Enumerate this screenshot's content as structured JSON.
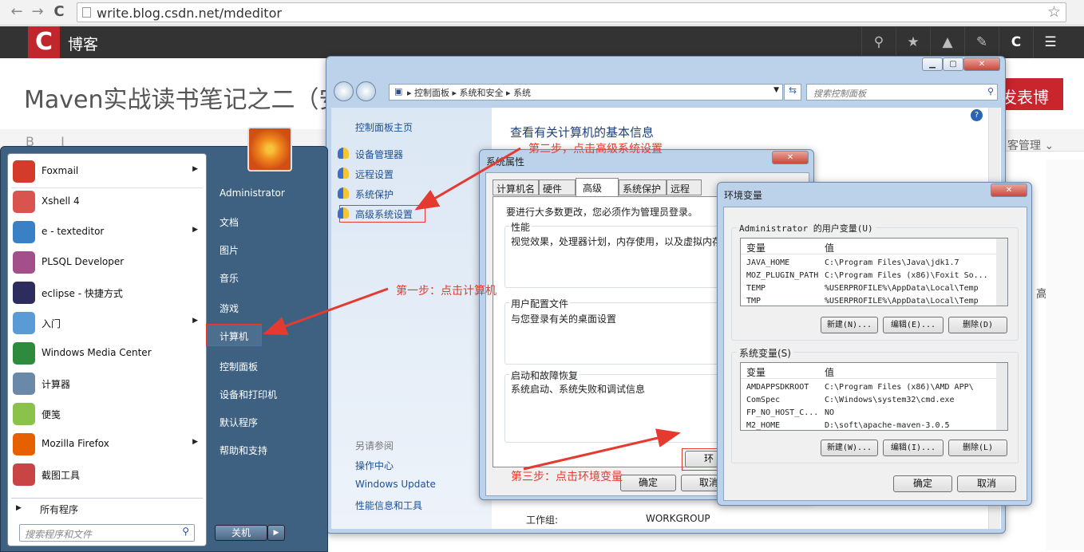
{
  "browser": {
    "url": "write.blog.csdn.net/mdeditor",
    "back": "←",
    "forward": "→",
    "reload": "C",
    "star": "☆"
  },
  "csdn": {
    "logo": "C",
    "blog": "博客"
  },
  "editor": {
    "title": "Maven实战读书笔记之二（安",
    "publish": "发表博客",
    "toolbar": "B I",
    "manage": "客管理",
    "fragment": "高"
  },
  "control_panel": {
    "breadcrumb": [
      "控制面板",
      "系统和安全",
      "系统"
    ],
    "search_placeholder": "搜索控制面板",
    "home": "控制面板主页",
    "links": [
      "设备管理器",
      "远程设置",
      "系统保护",
      "高级系统设置"
    ],
    "heading": "查看有关计算机的基本信息",
    "see_also": "另请参阅",
    "see_also_links": [
      "操作中心",
      "Windows Update",
      "性能信息和工具"
    ],
    "workgroup_label": "工作组:",
    "workgroup_value": "WORKGROUP"
  },
  "sys_props": {
    "title": "系统属性",
    "tabs": [
      "计算机名",
      "硬件",
      "高级",
      "系统保护",
      "远程"
    ],
    "admin_note": "要进行大多数更改，您必须作为管理员登录。",
    "perf_title": "性能",
    "perf_desc": "视觉效果，处理器计划，内存使用，以及虚拟内存",
    "profile_title": "用户配置文件",
    "profile_desc": "与您登录有关的桌面设置",
    "startup_title": "启动和故障恢复",
    "startup_desc": "系统启动、系统失败和调试信息",
    "env_btn": "环",
    "ok": "确定",
    "cancel": "取消"
  },
  "env_vars": {
    "title": "环境变量",
    "user_group": "Administrator 的用户变量(U)",
    "col_var": "变量",
    "col_val": "值",
    "user_rows": [
      [
        "JAVA_HOME",
        "C:\\Program Files\\Java\\jdk1.7"
      ],
      [
        "MOZ_PLUGIN_PATH",
        "C:\\Program Files (x86)\\Foxit So..."
      ],
      [
        "TEMP",
        "%USERPROFILE%\\AppData\\Local\\Temp"
      ],
      [
        "TMP",
        "%USERPROFILE%\\AppData\\Local\\Temp"
      ]
    ],
    "user_buttons": [
      "新建(N)...",
      "编辑(E)...",
      "删除(D)"
    ],
    "sys_group": "系统变量(S)",
    "sys_rows": [
      [
        "AMDAPPSDKROOT",
        "C:\\Program Files (x86)\\AMD APP\\"
      ],
      [
        "ComSpec",
        "C:\\Windows\\system32\\cmd.exe"
      ],
      [
        "FP_NO_HOST_C...",
        "NO"
      ],
      [
        "M2_HOME",
        "D:\\soft\\apache-maven-3.0.5"
      ]
    ],
    "sys_buttons": [
      "新建(W)...",
      "编辑(I)...",
      "删除(L)"
    ],
    "ok": "确定",
    "cancel": "取消"
  },
  "start_menu": {
    "programs": [
      {
        "label": "Foxmail",
        "arrow": true,
        "color": "#d33b2a",
        "icon": "foxmail-icon"
      },
      {
        "label": "Xshell 4",
        "arrow": false,
        "color": "#d9534f",
        "icon": "xshell-icon"
      },
      {
        "label": "e - texteditor",
        "arrow": true,
        "color": "#3a80c4",
        "icon": "texteditor-icon"
      },
      {
        "label": "PLSQL Developer",
        "arrow": false,
        "color": "#a24f8a",
        "icon": "plsql-icon"
      },
      {
        "label": "eclipse - 快捷方式",
        "arrow": false,
        "color": "#2c2d5e",
        "icon": "eclipse-icon"
      },
      {
        "label": "入门",
        "arrow": true,
        "color": "#5b9bd5",
        "icon": "getting-started-icon"
      },
      {
        "label": "Windows Media Center",
        "arrow": false,
        "color": "#2e8b3e",
        "icon": "media-center-icon"
      },
      {
        "label": "计算器",
        "arrow": false,
        "color": "#6a88a8",
        "icon": "calculator-icon"
      },
      {
        "label": "便笺",
        "arrow": false,
        "color": "#8bc34a",
        "icon": "sticky-notes-icon"
      },
      {
        "label": "Mozilla Firefox",
        "arrow": true,
        "color": "#e66000",
        "icon": "firefox-icon"
      },
      {
        "label": "截图工具",
        "arrow": false,
        "color": "#c94545",
        "icon": "snipping-tool-icon"
      }
    ],
    "all_programs": "所有程序",
    "search_placeholder": "搜索程序和文件",
    "right_items": [
      "Administrator",
      "文档",
      "图片",
      "音乐",
      "游戏",
      "计算机",
      "控制面板",
      "设备和打印机",
      "默认程序",
      "帮助和支持"
    ],
    "shutdown": "关机"
  },
  "annotations": {
    "step1": "第一步：点击计算机",
    "step2": "第二步，点击高级系统设置",
    "step3": "第三步：点击环境变量"
  }
}
